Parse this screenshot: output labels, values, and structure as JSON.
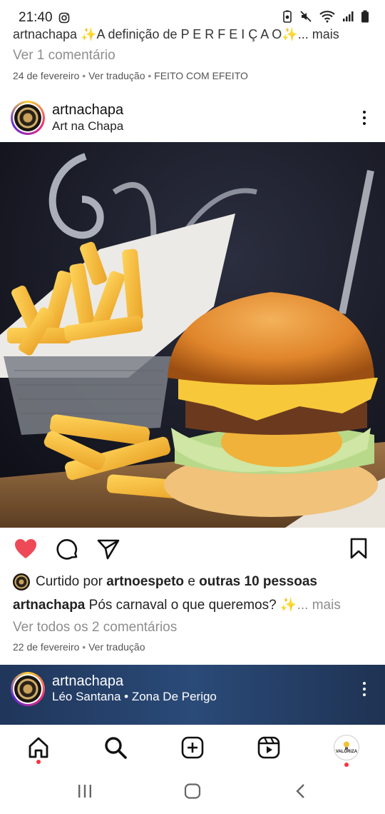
{
  "status_bar": {
    "time": "21:40"
  },
  "previous_post": {
    "caption_cut": "artnachapa ✨A definição de P E R F E I Ç A O✨... mais",
    "view_comments": "Ver 1 comentário",
    "date": "24 de fevereiro",
    "translate": "Ver tradução",
    "effect_label": "FEITO COM EFEITO"
  },
  "post": {
    "username": "artnachapa",
    "subtitle": "Art na Chapa",
    "liked_by_prefix": "Curtido por",
    "liked_by_user": "artnoespeto",
    "liked_by_and": "e",
    "liked_by_others": "outras 10 pessoas",
    "caption_user": "artnachapa",
    "caption_text": "Pós carnaval o que queremos? ✨",
    "caption_more": "... mais",
    "view_comments": "Ver todos os 2 comentários",
    "date": "22 de fevereiro",
    "translate": "Ver tradução",
    "liked": true
  },
  "next_post": {
    "username": "artnachapa",
    "audio": "Léo Santana • Zona De Perigo"
  },
  "bottom_nav": {
    "profile_label": "VALORiZA"
  },
  "colors": {
    "like_red": "#ed4956",
    "notification_dot": "#ff3040"
  }
}
